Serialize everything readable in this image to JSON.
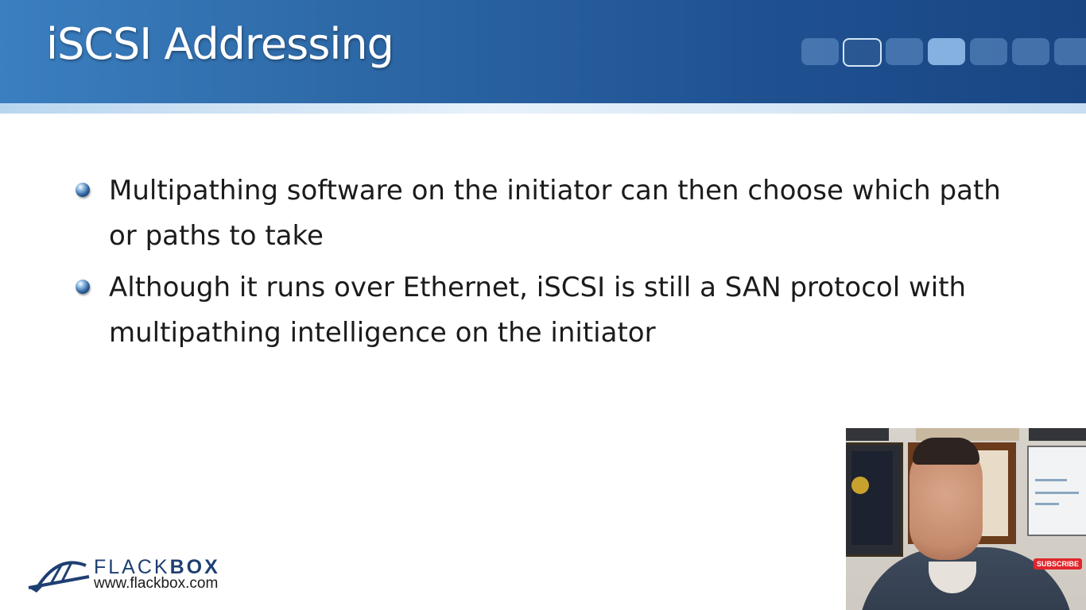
{
  "slide": {
    "title": "iSCSI Addressing",
    "bullets": [
      {
        "text": "Multipathing software on the initiator can then choose which path or paths to take"
      },
      {
        "text": "Although it runs over Ethernet, iSCSI is still a SAN protocol with multipathing intelligence on the initiator"
      }
    ]
  },
  "logo": {
    "brand_prefix": "FLACK",
    "brand_suffix": "BOX",
    "url": "www.flackbox.com"
  },
  "video_overlay": {
    "subscribe_label": "SUBSCRIBE"
  },
  "colors": {
    "header_dark": "#194583",
    "header_light": "#3b7fc0",
    "brand": "#1e3f72",
    "subscribe": "#e0262b"
  }
}
